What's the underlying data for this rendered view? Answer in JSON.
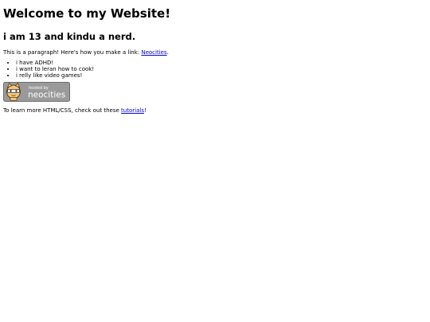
{
  "page": {
    "heading": "Welcome to my Website!",
    "subheading": "i am 13 and kindu a nerd.",
    "paragraph": {
      "text": "This is a paragraph! Here's how you make a link: ",
      "link_label": "Neocities",
      "suffix": "."
    },
    "list_items": [
      "i have ADHD!",
      "i want to leran how to cook!",
      "i relly like video games!"
    ],
    "badge": {
      "small_text": "hosted by",
      "brand_text": "neocities",
      "icon": "neocities-cat-icon"
    },
    "learn_more": {
      "text": "To learn more HTML/CSS, check out these ",
      "link_label": "tutorials",
      "suffix": "!"
    }
  },
  "colors": {
    "link": "#0000cc",
    "badge_bg": "#9a9a9a",
    "badge_border": "#6f6f6f"
  }
}
